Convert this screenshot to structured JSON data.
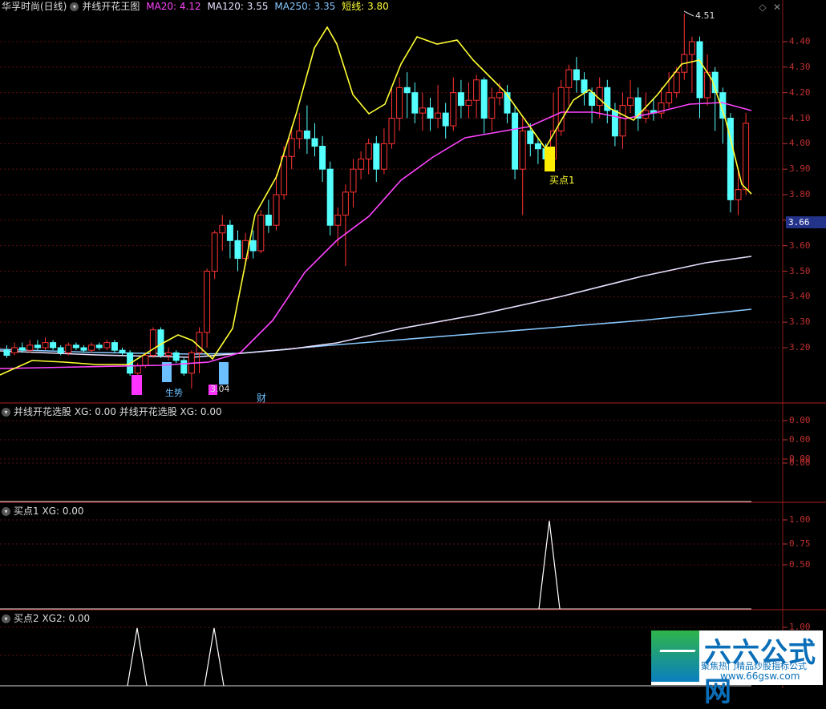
{
  "header_main": {
    "title": "华孚时尚(日线)",
    "indicator": "并线开花王图",
    "ma20_label": "MA20: 4.12",
    "ma120_label": "MA120: 3.55",
    "ma250_label": "MA250: 3.35",
    "short_label": "短线: 3.80",
    "colors": {
      "title": "#dddddd",
      "ma20": "#ff44ff",
      "ma120": "#e8e0ff",
      "ma250": "#88c8ff",
      "short": "#ffff33"
    }
  },
  "header_p2": {
    "label": "并线开花选股 XG: 0.00 并线开花选股 XG: 0.00"
  },
  "header_p3": {
    "label": "买点1 XG: 0.00"
  },
  "header_p4": {
    "label": "买点2 XG2: 0.00"
  },
  "price_axis": [
    "4.40",
    "4.30",
    "4.20",
    "4.10",
    "4.00",
    "3.90",
    "3.80",
    "3.70",
    "3.60",
    "3.50",
    "3.40",
    "3.30",
    "3.20"
  ],
  "current_price": "3.66",
  "p2_axis": [
    "0.00",
    "0.00",
    "0.00",
    "0.00"
  ],
  "p3_axis": [
    "1.00",
    "0.75",
    "0.50"
  ],
  "p4_axis": [
    "1.00",
    "0.50"
  ],
  "annotations": {
    "high": "4.51",
    "low": "3.04",
    "buy1": "买点1",
    "sheng": "生势",
    "cai": "财"
  },
  "watermark": {
    "title": "六六公式网",
    "subtitle": "聚焦热门精品炒股指标公式",
    "url": "www.66gsw.com"
  },
  "chart_data": [
    {
      "type": "candlestick",
      "title": "华孚时尚(日线)",
      "ylim": [
        3.04,
        4.51
      ],
      "series": [
        {
          "name": "MA20",
          "value_last": 4.12
        },
        {
          "name": "MA120",
          "value_last": 3.55
        },
        {
          "name": "MA250",
          "value_last": 3.35
        },
        {
          "name": "短线",
          "value_last": 3.8
        }
      ],
      "price_high": 4.51,
      "price_low": 3.04
    },
    {
      "type": "line",
      "series": [
        {
          "name": "并线开花选股 XG",
          "values": [
            0
          ]
        }
      ]
    },
    {
      "type": "line",
      "series": [
        {
          "name": "买点1 XG",
          "values": [
            0
          ]
        }
      ],
      "ylim": [
        0,
        1
      ]
    },
    {
      "type": "line",
      "series": [
        {
          "name": "买点2 XG2",
          "values": [
            0
          ]
        }
      ],
      "ylim": [
        0,
        1
      ]
    }
  ]
}
